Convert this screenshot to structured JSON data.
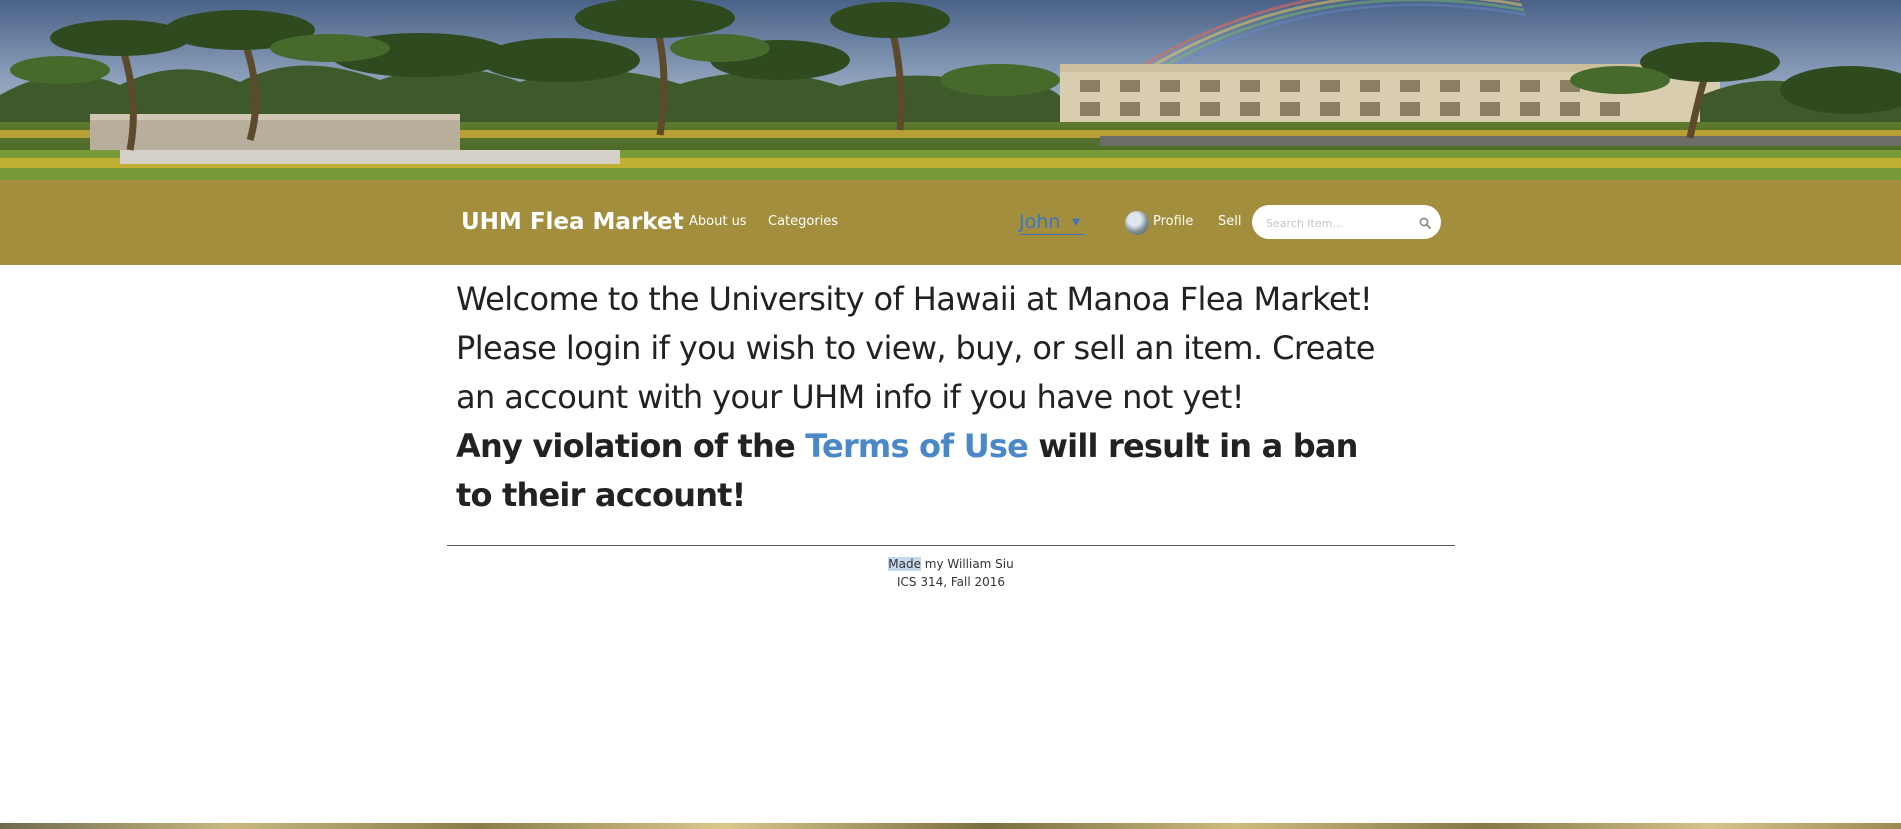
{
  "navbar": {
    "brand": "UHM Flea Market",
    "links": {
      "about": "About us",
      "categories": "Categories",
      "profile": "Profile",
      "sell": "Sell"
    },
    "user": {
      "name": "John",
      "caret": "▼"
    },
    "search": {
      "placeholder": "Search Item...",
      "value": ""
    }
  },
  "main": {
    "welcome": "Welcome to the University of Hawaii at Manoa Flea Market! Please login if you wish to view, buy, or sell an item. Create an account with your UHM info if you have not yet!",
    "warning": {
      "before": "Any violation of the ",
      "link": "Terms of Use",
      "after": " will result in a ban to their account!"
    }
  },
  "footer": {
    "made_highlighted": "Made",
    "made_rest": " my William Siu",
    "course": "ICS 314, Fall 2016"
  },
  "colors": {
    "navbar": "#a28e3c",
    "link": "#4a88c8",
    "user_link": "#3c78c0"
  },
  "icons": {
    "search": "search-icon",
    "dropdown": "caret-down-icon",
    "avatar": "avatar"
  }
}
